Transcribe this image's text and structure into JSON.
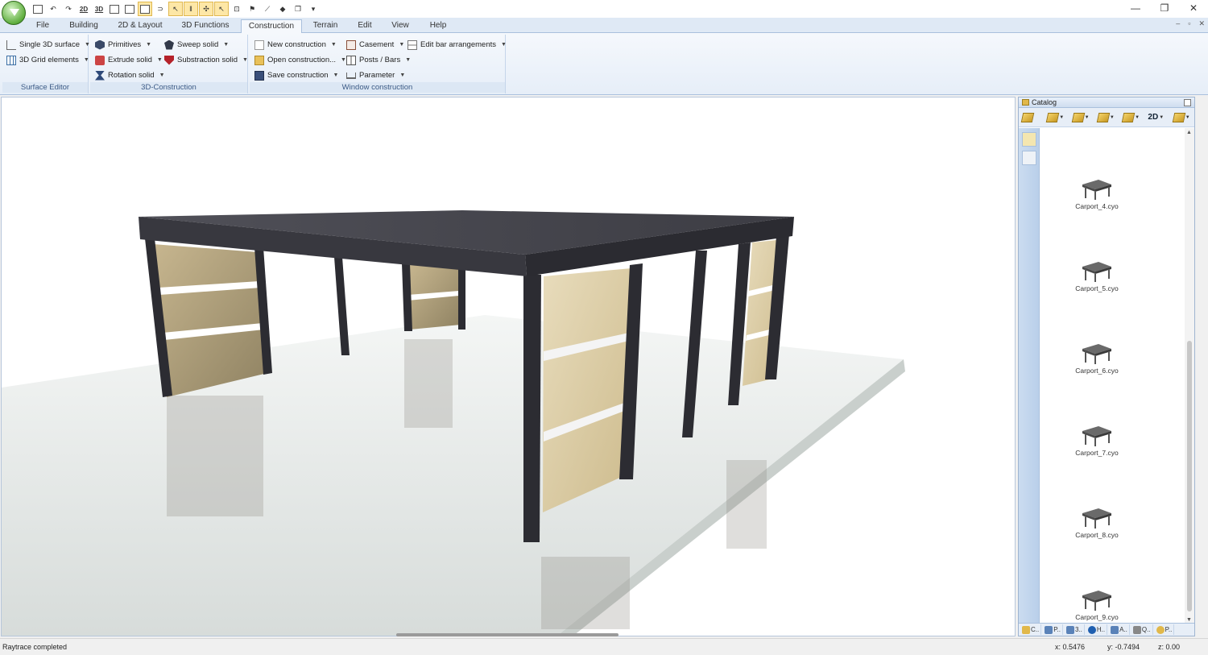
{
  "ribbon_tabs": [
    "File",
    "Building",
    "2D & Layout",
    "3D Functions",
    "Construction",
    "Terrain",
    "Edit",
    "View",
    "Help"
  ],
  "active_tab": "Construction",
  "qat": {
    "t2d": "2D",
    "t3d": "3D",
    "more": "▾"
  },
  "window_controls": {
    "minimize": "—",
    "restore": "❐",
    "close": "✕"
  },
  "mdi_controls": {
    "minimize": "–",
    "restore": "▫",
    "close": "✕"
  },
  "ribbon": {
    "surface_editor": {
      "label": "Surface Editor",
      "single_3d_surface": "Single 3D surface",
      "grid_3d_elements": "3D Grid elements"
    },
    "construction_3d": {
      "label": "3D-Construction",
      "primitives": "Primitives",
      "extrude_solid": "Extrude solid",
      "rotation_solid": "Rotation solid",
      "sweep_solid": "Sweep solid",
      "substraction_solid": "Substraction solid"
    },
    "window_construction": {
      "label": "Window construction",
      "new_construction": "New construction",
      "open_construction": "Open construction...",
      "save_construction": "Save construction",
      "casement": "Casement",
      "posts_bars": "Posts / Bars",
      "parameter": "Parameter",
      "edit_bar_arrangements": "Edit bar arrangements"
    }
  },
  "catalog": {
    "title": "Catalog",
    "toolbar_2d": "2D",
    "items": [
      "Carport_4.cyo",
      "Carport_5.cyo",
      "Carport_6.cyo",
      "Carport_7.cyo",
      "Carport_8.cyo",
      "Carport_9.cyo"
    ],
    "bottom_tabs": [
      "C..",
      "P..",
      "3..",
      "H..",
      "A..",
      "Q..",
      "P.."
    ]
  },
  "status": {
    "message": "Raytrace completed",
    "x": "x: 0.5476",
    "y": "y: -0.7494",
    "z": "z: 0.00"
  },
  "colors": {
    "accent": "#dfe9f5",
    "roof": "#4a4a52",
    "post": "#2d2d33",
    "panel": "#d9c9a0",
    "floor": "#e4e8e6"
  }
}
